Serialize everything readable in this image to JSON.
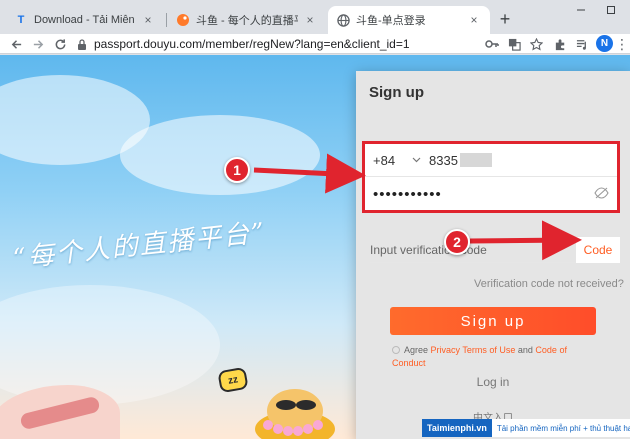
{
  "browser": {
    "tabs": [
      {
        "title": "Download - Tải Miễn Phí VN - P",
        "icon": "letter-t-icon",
        "active": false
      },
      {
        "title": "斗鱼 - 每个人的直播平台",
        "icon": "douyu-icon",
        "active": false
      },
      {
        "title": "斗鱼-单点登录",
        "icon": "globe-icon",
        "active": true
      }
    ],
    "new_tab": "+",
    "address": "passport.douyu.com/member/regNew?lang=en&client_id=1",
    "profile_initial": "N"
  },
  "page": {
    "slogan": "“每个人的直播平台”",
    "sticker": "zz"
  },
  "modal": {
    "title": "Sign up",
    "country_code": "+84",
    "phone_value": "8335",
    "password_value": "•••••••••••",
    "code_placeholder": "Input verification code",
    "code_button": "Code",
    "verification_link": "Verification code not received?",
    "signup_button": "Sign up",
    "agree_prefix": "Agree ",
    "privacy_terms": "Privacy Terms of Use",
    "and_text": " and ",
    "code_of_conduct": "Code of Conduct",
    "login_link": "Log in",
    "chinese_link": "中文入口"
  },
  "annotations": {
    "badge_1": "1",
    "badge_2": "2",
    "color": "#e0242e"
  },
  "watermark": {
    "logo": "Taimienphi.vn",
    "tagline": "Tải phần mềm miễn phí + thủ thuật hay"
  },
  "colors": {
    "accent": "#ff5d23",
    "annotation_red": "#e0242e",
    "profile_blue": "#1a73e8"
  }
}
